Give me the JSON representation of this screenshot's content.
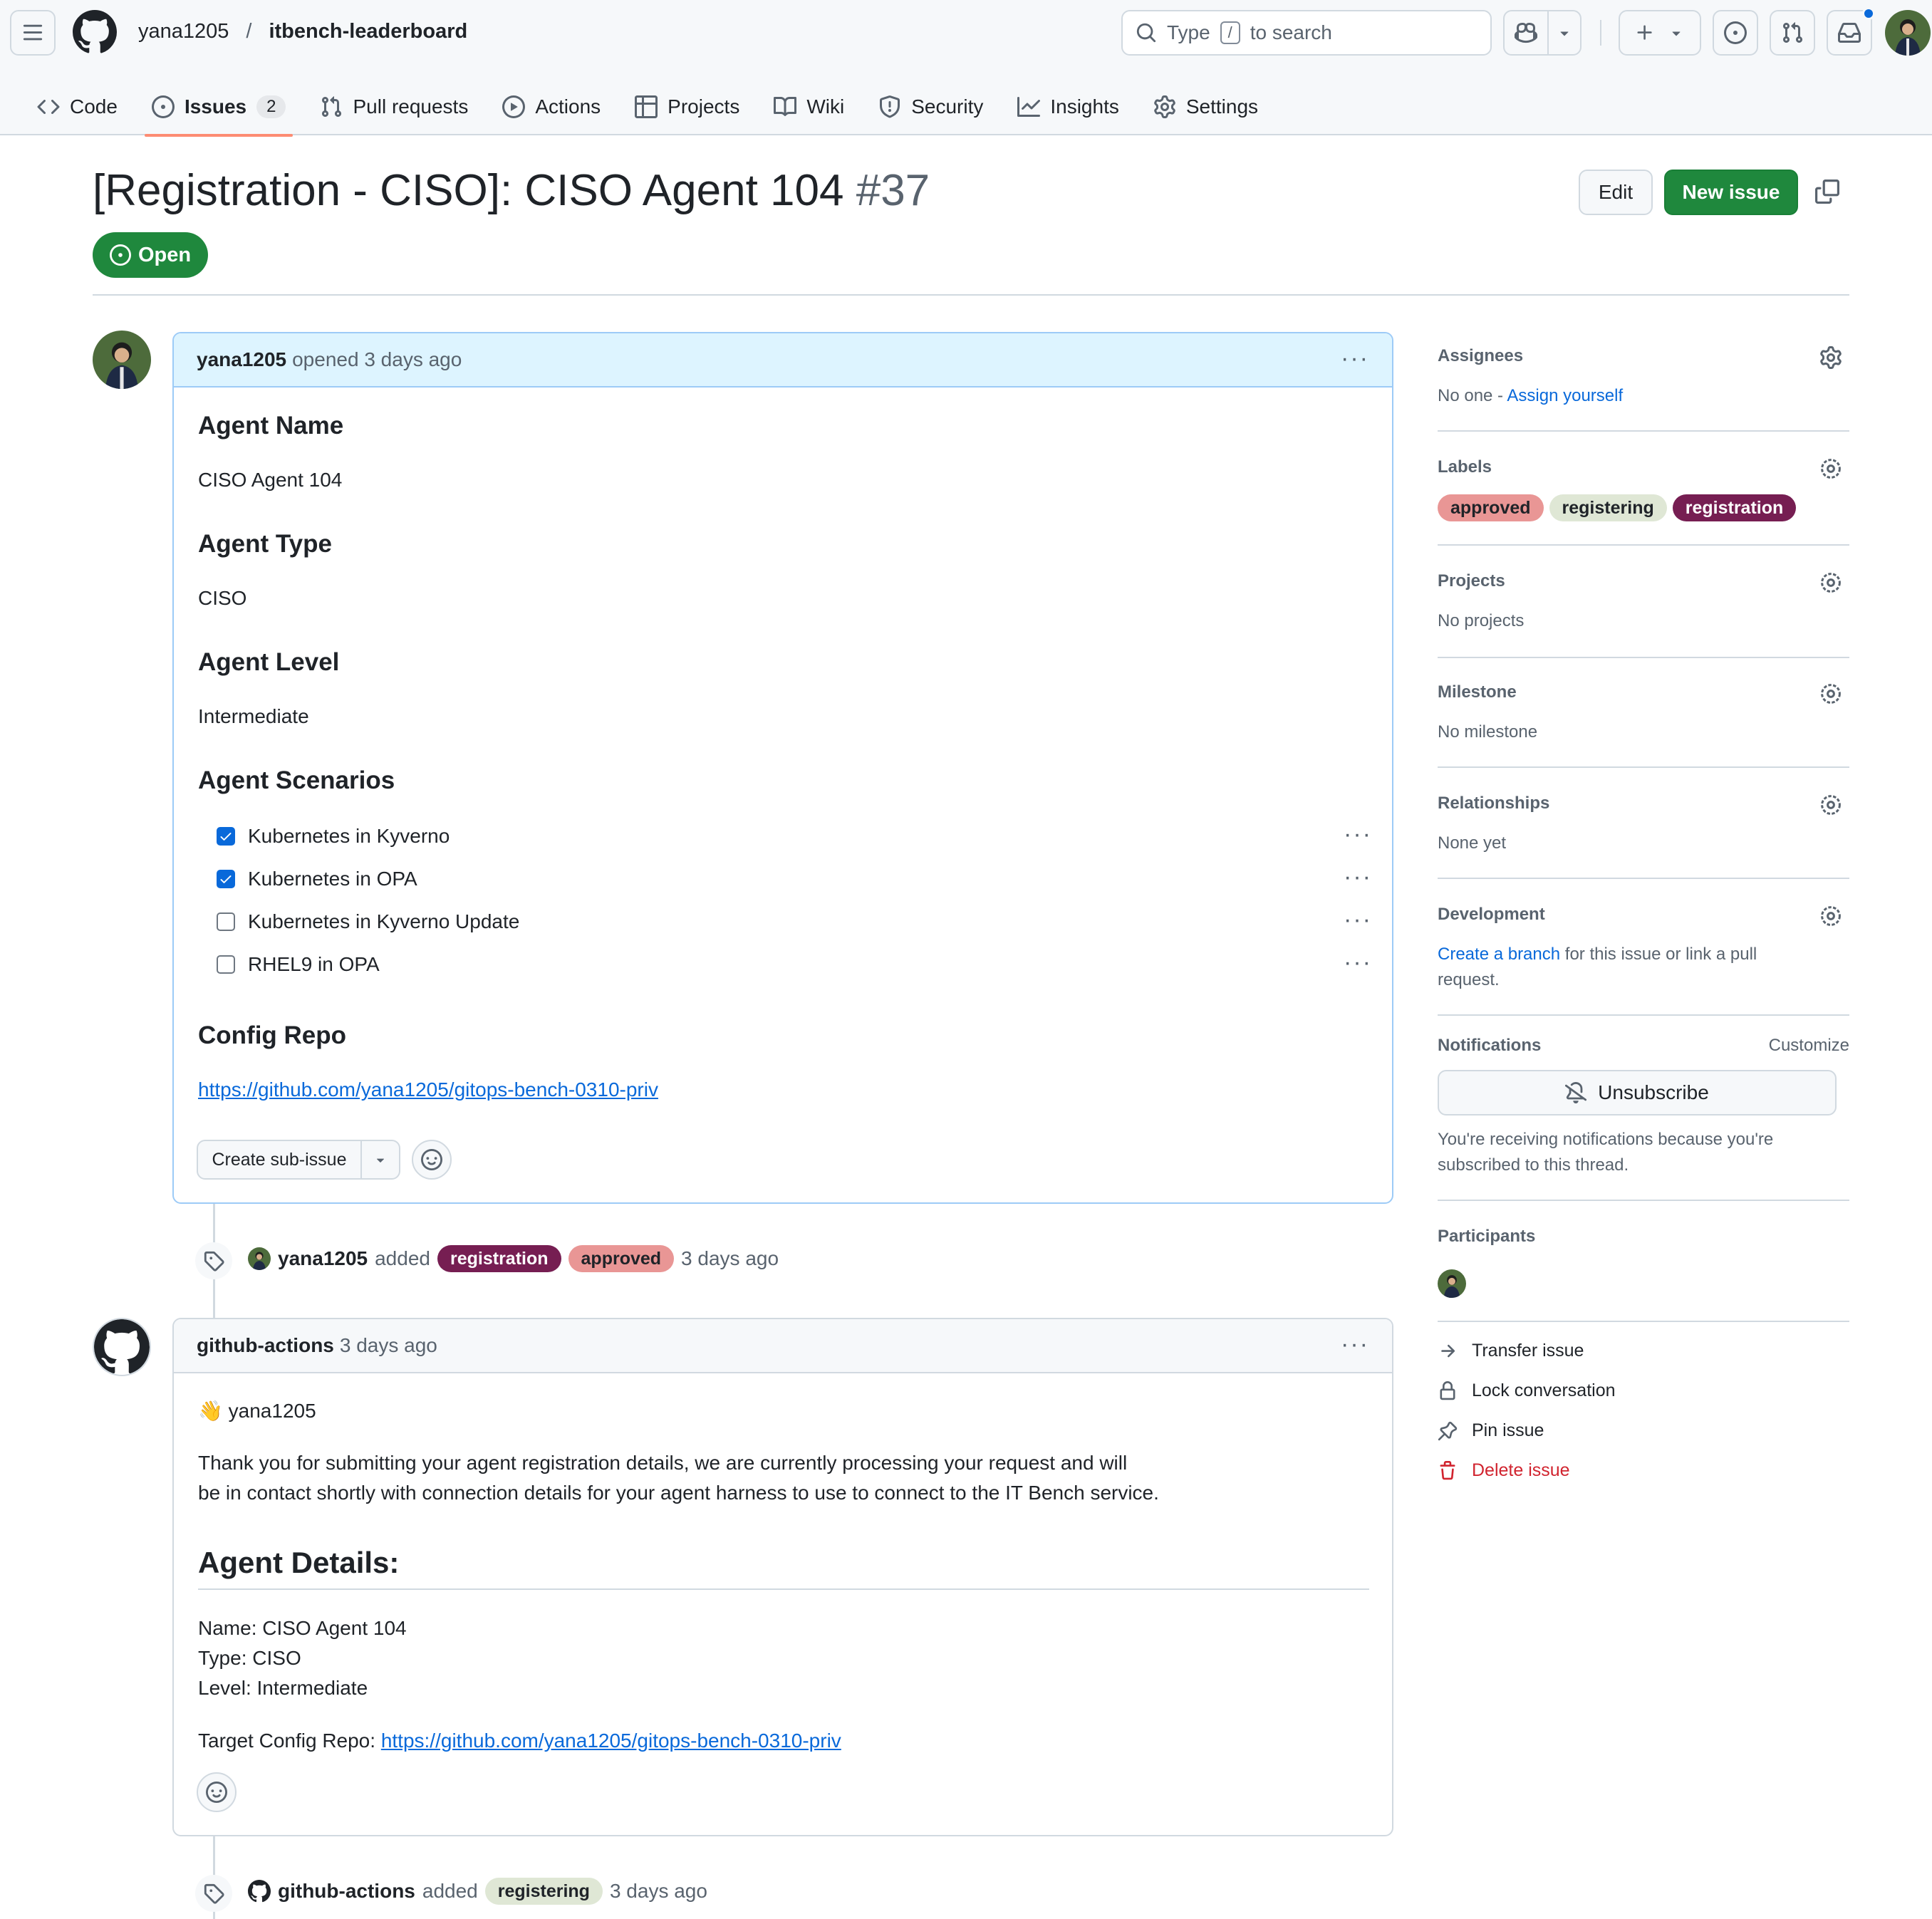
{
  "header": {
    "owner": "yana1205",
    "separator": "/",
    "repo": "itbench-leaderboard",
    "search_prefix": "Type",
    "search_key": "/",
    "search_suffix": "to search"
  },
  "tabs": [
    {
      "label": "Code",
      "icon": "code-icon"
    },
    {
      "label": "Issues",
      "icon": "issue-opened-icon",
      "count": "2"
    },
    {
      "label": "Pull requests",
      "icon": "git-pull-request-icon"
    },
    {
      "label": "Actions",
      "icon": "play-icon"
    },
    {
      "label": "Projects",
      "icon": "table-icon"
    },
    {
      "label": "Wiki",
      "icon": "book-icon"
    },
    {
      "label": "Security",
      "icon": "shield-icon"
    },
    {
      "label": "Insights",
      "icon": "graph-icon"
    },
    {
      "label": "Settings",
      "icon": "gear-icon"
    }
  ],
  "issue": {
    "title": "[Registration - CISO]: CISO Agent 104",
    "number": "#37",
    "state": "Open",
    "edit_label": "Edit",
    "new_issue_label": "New issue"
  },
  "first_comment": {
    "author": "yana1205",
    "meta": "opened 3 days ago",
    "sections": {
      "name_heading": "Agent Name",
      "name_value": "CISO Agent 104",
      "type_heading": "Agent Type",
      "type_value": "CISO",
      "level_heading": "Agent Level",
      "level_value": "Intermediate",
      "scenarios_heading": "Agent Scenarios",
      "config_heading": "Config Repo",
      "config_link": "https://github.com/yana1205/gitops-bench-0310-priv"
    },
    "tasks": [
      {
        "label": "Kubernetes in Kyverno",
        "checked": true
      },
      {
        "label": "Kubernetes in OPA",
        "checked": true
      },
      {
        "label": "Kubernetes in Kyverno Update",
        "checked": false
      },
      {
        "label": "RHEL9 in OPA",
        "checked": false
      }
    ],
    "create_sub_issue": "Create sub-issue"
  },
  "event1": {
    "actor": "yana1205",
    "action": "added",
    "labels": [
      "registration",
      "approved"
    ],
    "time": "3 days ago"
  },
  "second_comment": {
    "author": "github-actions",
    "meta": "3 days ago",
    "greeting_emoji": "👋",
    "greeting": "yana1205",
    "para_line1": "Thank you for submitting your agent registration details, we are currently processing your request and will",
    "para_line2": "be in contact shortly with connection details for your agent harness to use to connect to the IT Bench service.",
    "details_heading": "Agent Details:",
    "name_line": "Name: CISO Agent 104",
    "type_line": "Type: CISO",
    "level_line": "Level: Intermediate",
    "target_prefix": "Target Config Repo:",
    "target_link": "https://github.com/yana1205/gitops-bench-0310-priv"
  },
  "event2": {
    "actor": "github-actions",
    "action": "added",
    "label": "registering",
    "time": "3 days ago"
  },
  "sidebar": {
    "assignees": {
      "heading": "Assignees",
      "none": "No one -",
      "assign_link": "Assign yourself"
    },
    "labels": {
      "heading": "Labels",
      "items": [
        "approved",
        "registering",
        "registration"
      ]
    },
    "projects": {
      "heading": "Projects",
      "value": "No projects"
    },
    "milestone": {
      "heading": "Milestone",
      "value": "No milestone"
    },
    "relationships": {
      "heading": "Relationships",
      "value": "None yet"
    },
    "development": {
      "heading": "Development",
      "link": "Create a branch",
      "text1": "for this issue or link a pull",
      "text2": "request."
    },
    "notifications": {
      "heading": "Notifications",
      "customize": "Customize",
      "button": "Unsubscribe",
      "note1": "You're receiving notifications because you're",
      "note2": "subscribed to this thread."
    },
    "participants": {
      "heading": "Participants"
    },
    "actions": {
      "transfer": "Transfer issue",
      "lock": "Lock conversation",
      "pin": "Pin issue",
      "delete": "Delete issue"
    }
  },
  "colors": {
    "green": "#1f883d",
    "link": "#0969da",
    "approved": "#e99695",
    "registering": "#dfe7d5",
    "registration": "#761e52",
    "danger": "#d1242f"
  }
}
